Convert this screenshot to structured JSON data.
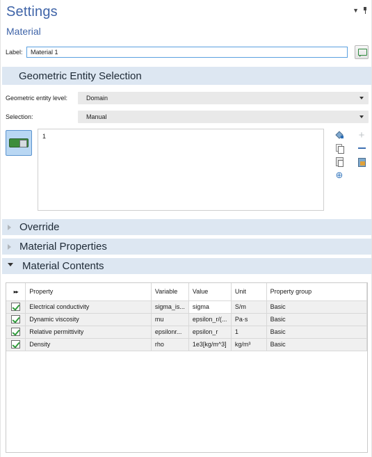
{
  "header": {
    "title": "Settings",
    "subtitle": "Material",
    "menu_icon": "dropdown-triangle-icon",
    "pin_icon": "pin-icon"
  },
  "label_field": {
    "label": "Label:",
    "value": "Material 1"
  },
  "geometric_entity_selection": {
    "title": "Geometric Entity Selection",
    "entity_level_label": "Geometric entity level:",
    "entity_level_value": "Domain",
    "selection_label": "Selection:",
    "selection_value": "Manual",
    "selected_items": [
      "1"
    ],
    "toolbar_icons": [
      "paint-selection-icon",
      "copy-selection-icon",
      "paste-selection-icon",
      "zoom-to-selection-icon",
      "add-to-selection-icon",
      "remove-from-selection-icon",
      "clear-selection-icon"
    ]
  },
  "sections": {
    "override": "Override",
    "material_properties": "Material Properties",
    "material_contents": "Material Contents"
  },
  "table": {
    "columns": [
      "▸▸",
      "Property",
      "Variable",
      "Value",
      "Unit",
      "Property group"
    ],
    "rows": [
      {
        "checked": true,
        "property": "Electrical conductivity",
        "variable": "sigma_is...",
        "value": "sigma",
        "unit": "S/m",
        "group": "Basic"
      },
      {
        "checked": true,
        "property": "Dynamic viscosity",
        "variable": "mu",
        "value": "epsilon_r/(...",
        "unit": "Pa·s",
        "group": "Basic"
      },
      {
        "checked": true,
        "property": "Relative permittivity",
        "variable": "epsilonr...",
        "value": "epsilon_r",
        "unit": "1",
        "group": "Basic"
      },
      {
        "checked": true,
        "property": "Density",
        "variable": "rho",
        "value": "1e3[kg/m^3]",
        "unit": "kg/m³",
        "group": "Basic"
      }
    ]
  },
  "colors": {
    "title_blue": "#3f64a8",
    "section_bg": "#dde7f2",
    "check_green": "#2f9a3a"
  }
}
